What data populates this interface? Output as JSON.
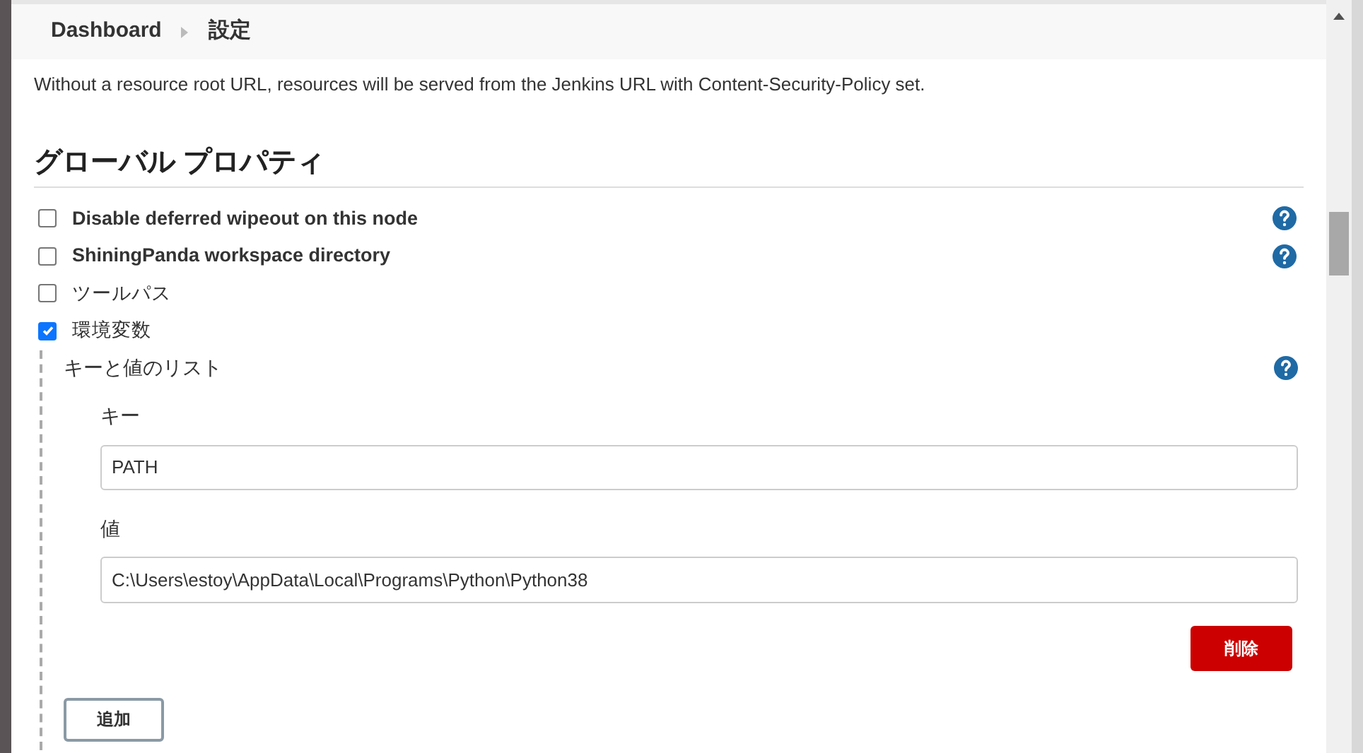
{
  "breadcrumb": [
    {
      "label": "Dashboard"
    },
    {
      "label": "設定"
    }
  ],
  "description": "Without a resource root URL, resources will be served from the Jenkins URL with Content-Security-Policy set.",
  "section": {
    "title": "グローバル プロパティ"
  },
  "properties": [
    {
      "label": "Disable deferred wipeout on this node",
      "checked": false,
      "help": true,
      "bold": true
    },
    {
      "label": "ShiningPanda workspace directory",
      "checked": false,
      "help": true,
      "bold": true
    },
    {
      "label": "ツールパス",
      "checked": false,
      "help": false,
      "bold": false
    },
    {
      "label": "環境変数",
      "checked": true,
      "help": false,
      "bold": false
    }
  ],
  "env_vars": {
    "title": "キーと値のリスト",
    "help": true,
    "entries": [
      {
        "key_label": "キー",
        "key": "PATH",
        "value_label": "値",
        "value": "C:\\Users\\estoy\\AppData\\Local\\Programs\\Python\\Python38",
        "delete_button": "削除"
      }
    ],
    "add_button": "追加"
  }
}
